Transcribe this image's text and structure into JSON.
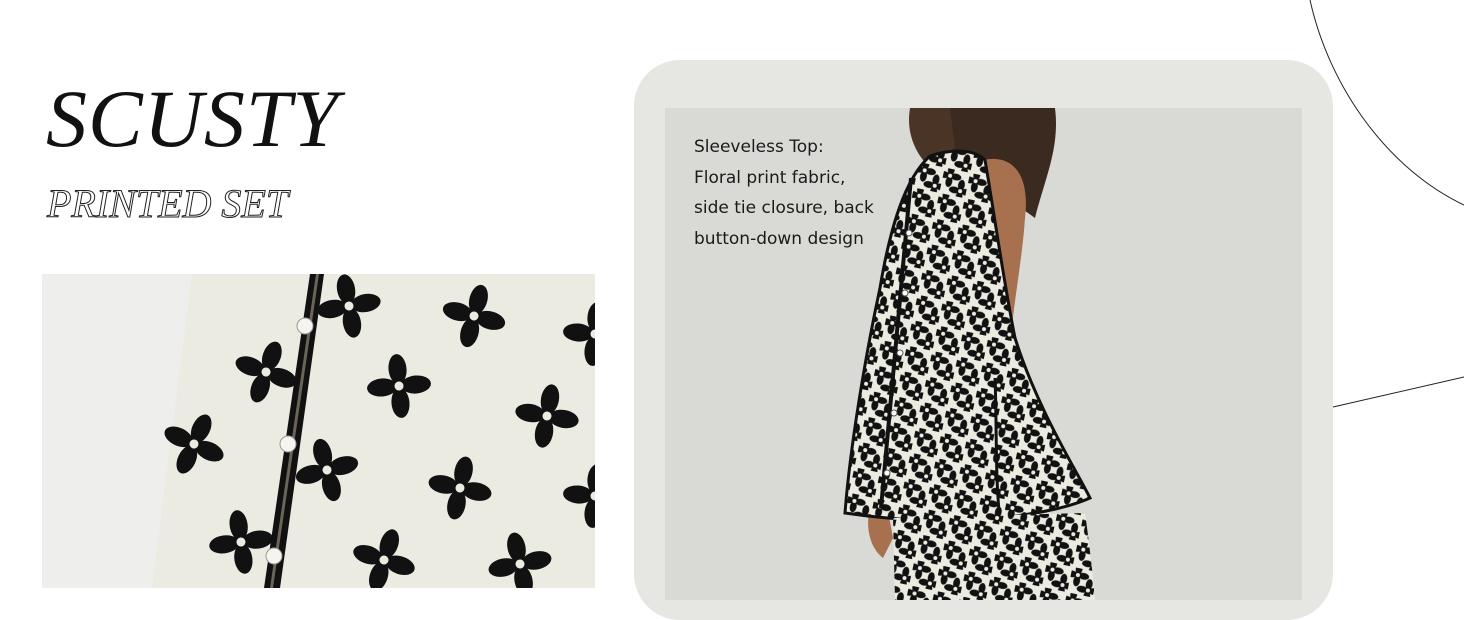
{
  "brand": {
    "title": "SCUSTY",
    "subtitle": "PRINTED SET"
  },
  "feature": {
    "lines": [
      "Sleeveless Top:",
      "Floral print fabric,",
      "side tie closure, back",
      "button-down design"
    ]
  },
  "colors": {
    "fabric": "#ecebe2",
    "print": "#111111",
    "card": "#e6e6e3",
    "photo_bg": "#d9d9d6"
  }
}
